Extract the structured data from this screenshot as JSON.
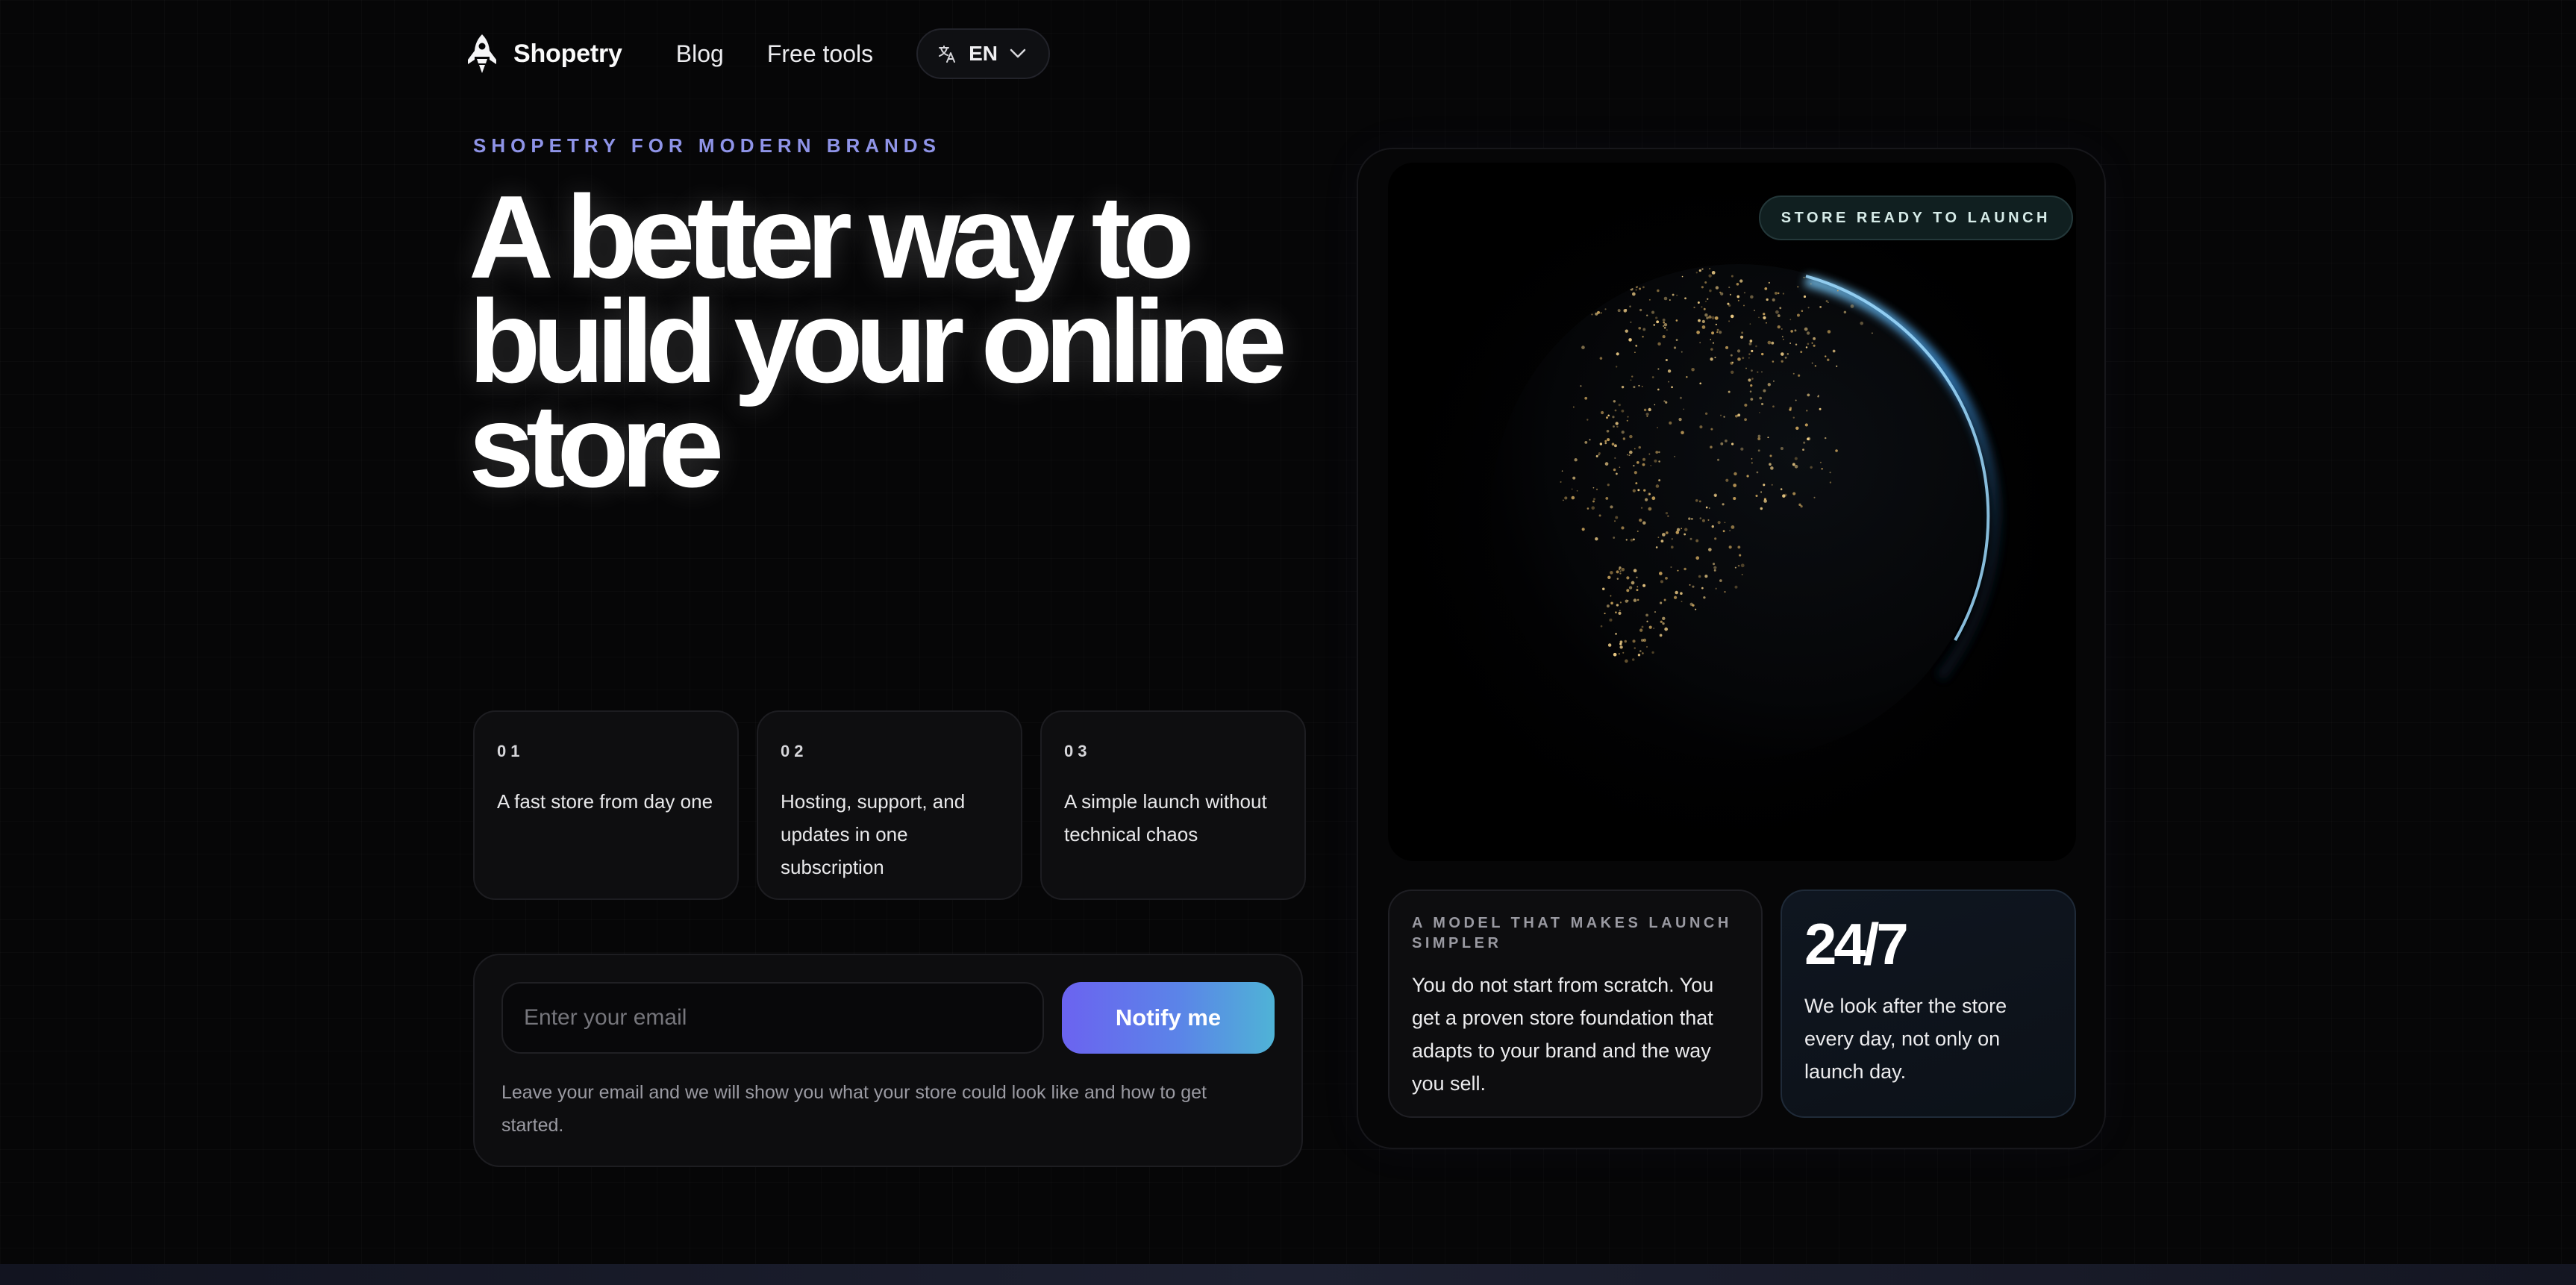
{
  "header": {
    "brand": "Shopetry",
    "nav": [
      {
        "label": "Blog"
      },
      {
        "label": "Free tools"
      }
    ],
    "language": "EN"
  },
  "hero": {
    "eyebrow": "SHOPETRY FOR MODERN BRANDS",
    "headline": "A better way to build your online store"
  },
  "features": [
    {
      "number": "01",
      "text": "A fast store from day one"
    },
    {
      "number": "02",
      "text": "Hosting, support, and updates in one subscription"
    },
    {
      "number": "03",
      "text": "A simple launch without technical chaos"
    }
  ],
  "signup": {
    "placeholder": "Enter your email",
    "value": "",
    "button": "Notify me",
    "note": "Leave your email and we will show you what your store could look like and how to get started."
  },
  "visual": {
    "badge": "STORE READY TO LAUNCH",
    "model_eyebrow": "A MODEL THAT MAKES LAUNCH SIMPLER",
    "model_text": "You do not start from scratch. You get a proven store foundation that adapts to your brand and the way you sell.",
    "stat_value": "24/7",
    "stat_text": "We look after the store every day, not only on launch day."
  },
  "colors": {
    "accent": "#8f94e8",
    "button_start": "#6b63f0",
    "button_end": "#4fb3d6",
    "background": "#060607"
  },
  "icons": {
    "logo": "rocket-icon",
    "language": "translate-icon",
    "dropdown": "chevron-down-icon"
  }
}
